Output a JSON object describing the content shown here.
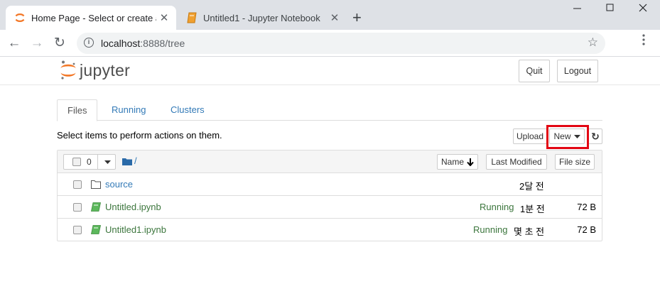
{
  "browser": {
    "tabs": [
      {
        "title": "Home Page - Select or create a",
        "active": true
      },
      {
        "title": "Untitled1 - Jupyter Notebook",
        "active": false
      }
    ],
    "new_tab_glyph": "+",
    "window_controls": {
      "minimize": "—",
      "maximize": "☐",
      "close": "✕"
    },
    "url_host": "localhost",
    "url_rest": ":8888/tree",
    "back_glyph": "←",
    "forward_glyph": "→",
    "reload_glyph": "↻",
    "star_glyph": "☆",
    "close_glyph": "✕"
  },
  "header": {
    "logo_text": "jupyter",
    "quit_label": "Quit",
    "logout_label": "Logout"
  },
  "tabs": [
    {
      "label": "Files"
    },
    {
      "label": "Running"
    },
    {
      "label": "Clusters"
    }
  ],
  "toolbar": {
    "hint": "Select items to perform actions on them.",
    "upload_label": "Upload",
    "new_label": "New",
    "refresh_glyph": "↻"
  },
  "list_header": {
    "selected_count": "0",
    "path": "/",
    "sort_name": "Name",
    "sort_name_arrow": "🡓",
    "sort_modified": "Last Modified",
    "sort_size": "File size"
  },
  "items": [
    {
      "name": "source",
      "type": "folder",
      "status": "",
      "modified": "2달 전",
      "size": ""
    },
    {
      "name": "Untitled.ipynb",
      "type": "notebook",
      "status": "Running",
      "modified": "1분 전",
      "size": "72 B"
    },
    {
      "name": "Untitled1.ipynb",
      "type": "notebook",
      "status": "Running",
      "modified": "몇 초 전",
      "size": "72 B"
    }
  ],
  "colors": {
    "link": "#337ab7",
    "running": "#3c763d",
    "highlight": "#e30613",
    "jupyter_orange": "#f37726"
  }
}
